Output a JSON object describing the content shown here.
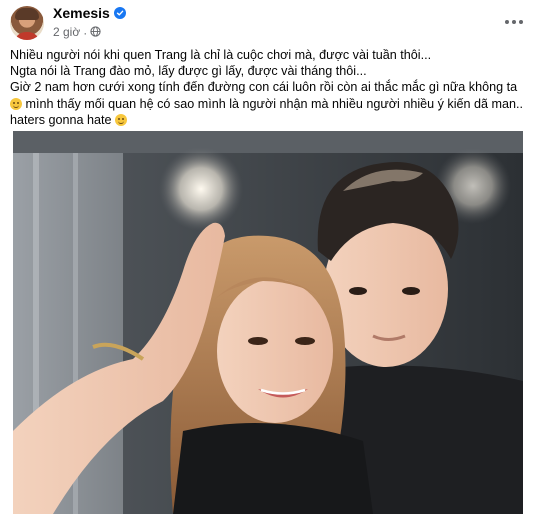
{
  "post": {
    "author": "Xemesis",
    "verified_icon": "verified-badge-icon",
    "timestamp": "2 giờ",
    "separator": "·",
    "audience_icon": "globe-icon",
    "more_icon": "more-options-icon",
    "lines": [
      "Nhiều người nói khi quen Trang là chỉ là cuộc chơi mà, được vài tuần thôi...",
      "Ngta nói là Trang đào mỏ, lấy được gì lấy, được vài tháng thôi...",
      "Giờ 2 nam hơn cưới xong tính đến đường con cái luôn rồi còn ai thắc mắc gì nữa không ta",
      "mình thấy mối quan hệ có sao mình là người nhận mà nhiều người nhiều ý kiến dã man..",
      "haters gonna hate"
    ],
    "emoji": {
      "thinking": "thinking-face-emoji",
      "smile": "upside-down-face-emoji"
    },
    "photo": {
      "description_icon": "selfie-photo"
    }
  },
  "colors": {
    "brand_blue": "#1877f2",
    "secondary_text": "#65676b",
    "primary_text": "#050505"
  }
}
